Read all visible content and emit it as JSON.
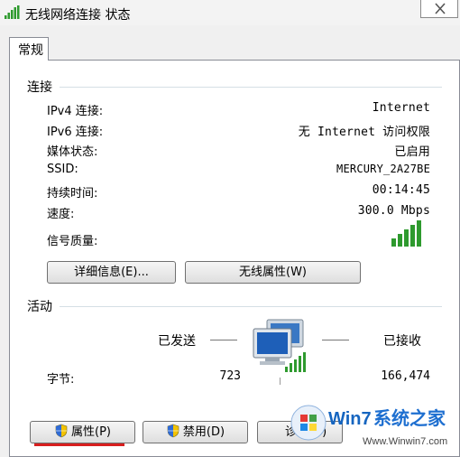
{
  "window": {
    "title": "无线网络连接 状态"
  },
  "tabs": [
    {
      "label": "常规"
    }
  ],
  "connection": {
    "heading": "连接",
    "rows": [
      {
        "label": "IPv4 连接:",
        "value": "Internet"
      },
      {
        "label": "IPv6 连接:",
        "value": "无 Internet 访问权限"
      },
      {
        "label": "媒体状态:",
        "value": "已启用"
      },
      {
        "label": "SSID:",
        "value": "MERCURY_2A27BE"
      },
      {
        "label": "持续时间:",
        "value": "00:14:45"
      },
      {
        "label": "速度:",
        "value": "300.0 Mbps"
      }
    ],
    "signal_label": "信号质量:",
    "signal_bars": 5,
    "details_button": "详细信息(E)...",
    "wireless_props_button": "无线属性(W)"
  },
  "activity": {
    "heading": "活动",
    "sent_label": "已发送",
    "received_label": "已接收",
    "bytes_label": "字节:",
    "bytes_sent": "723",
    "bytes_received": "166,474"
  },
  "buttons": {
    "properties": "属性(P)",
    "disable": "禁用(D)",
    "diagnose": "诊断(G)"
  },
  "watermark": {
    "brand": "Win7系统之家",
    "url": "Www.Winwin7.com"
  },
  "colors": {
    "signal_green": "#2e9a2e",
    "accent_underline": "#d81e1e"
  }
}
